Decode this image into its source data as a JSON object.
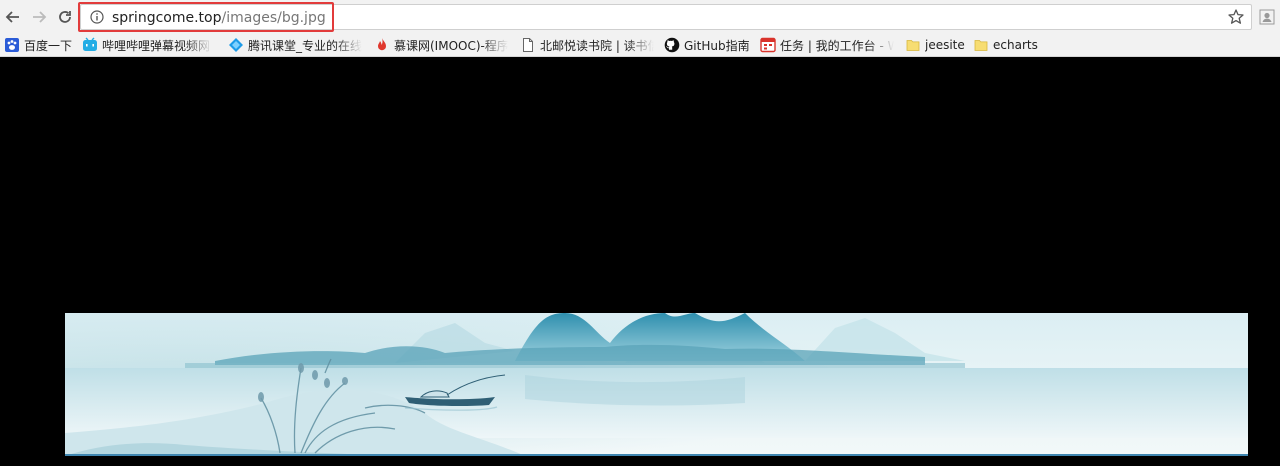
{
  "toolbar": {
    "back_icon": "arrow-left-icon",
    "forward_icon": "arrow-right-icon",
    "reload_icon": "reload-icon",
    "url_host": "springcome.top",
    "url_path": "/images/bg.jpg",
    "info_icon": "info-icon",
    "bookmark_star_icon": "star-icon",
    "profile_icon": "profile-icon",
    "highlight_color": "#e23b3b"
  },
  "bookmarks": [
    {
      "label": "百度一下",
      "icon": "baidu-icon"
    },
    {
      "label": "哔哩哔哩弹幕视频网",
      "icon": "bilibili-icon"
    },
    {
      "label": "腾讯课堂_专业的在线",
      "icon": "tencent-classroom-icon"
    },
    {
      "label": "慕课网(IMOOC)-程序",
      "icon": "imooc-flame-icon"
    },
    {
      "label": "北邮悦读书院 | 读书信",
      "icon": "page-icon"
    },
    {
      "label": "GitHub指南",
      "icon": "github-icon"
    },
    {
      "label": "任务 | 我的工作台 - W",
      "icon": "task-icon"
    },
    {
      "label": "jeesite",
      "icon": "folder-icon"
    },
    {
      "label": "echarts",
      "icon": "folder-icon"
    }
  ],
  "content": {
    "background": "#000000",
    "image_description_icon": "landscape-painting-image"
  }
}
